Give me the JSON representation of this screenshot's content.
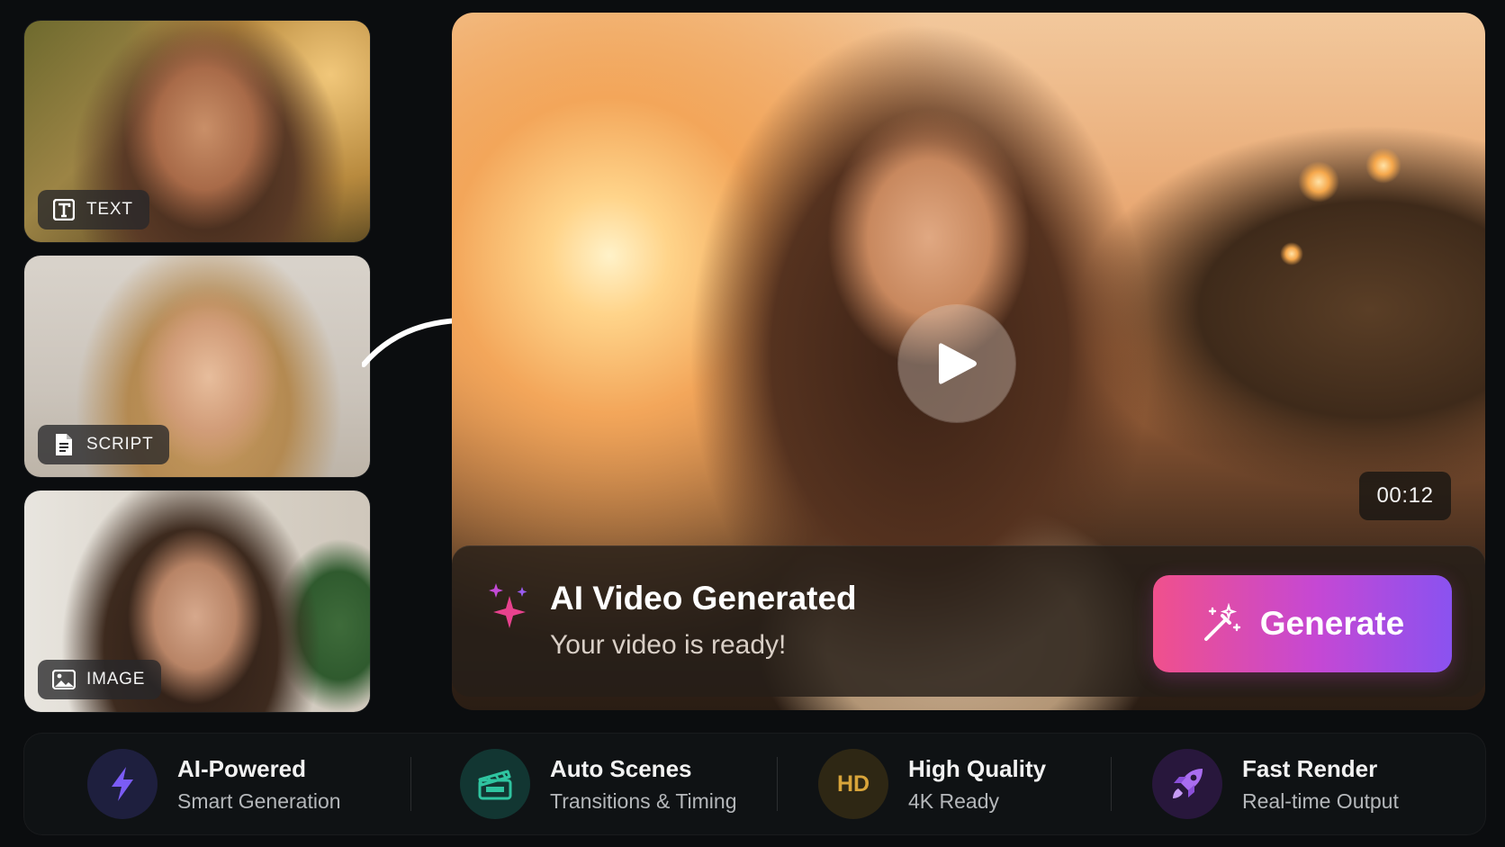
{
  "thumbnails": [
    {
      "label": "TEXT",
      "icon": "text-icon"
    },
    {
      "label": "SCRIPT",
      "icon": "document-icon"
    },
    {
      "label": "IMAGE",
      "icon": "image-icon"
    }
  ],
  "preview": {
    "duration": "00:12",
    "title": "AI Video Generated",
    "subtitle": "Your video is ready!",
    "generate_label": "Generate"
  },
  "features": [
    {
      "title": "AI-Powered",
      "subtitle": "Smart Generation",
      "icon": "lightning-icon"
    },
    {
      "title": "Auto Scenes",
      "subtitle": "Transitions & Timing",
      "icon": "clapperboard-icon"
    },
    {
      "title": "High Quality",
      "subtitle": "4K Ready",
      "icon": "hd-icon",
      "badge": "HD"
    },
    {
      "title": "Fast Render",
      "subtitle": "Real-time Output",
      "icon": "rocket-icon"
    }
  ],
  "colors": {
    "background": "#0b0d0f",
    "generate_gradient_start": "#f0508c",
    "generate_gradient_end": "#8a52f0",
    "lightning": "#7b5cf5",
    "clapperboard": "#2fc4a0",
    "hd": "#d8a43a",
    "rocket": "#a96df0"
  }
}
